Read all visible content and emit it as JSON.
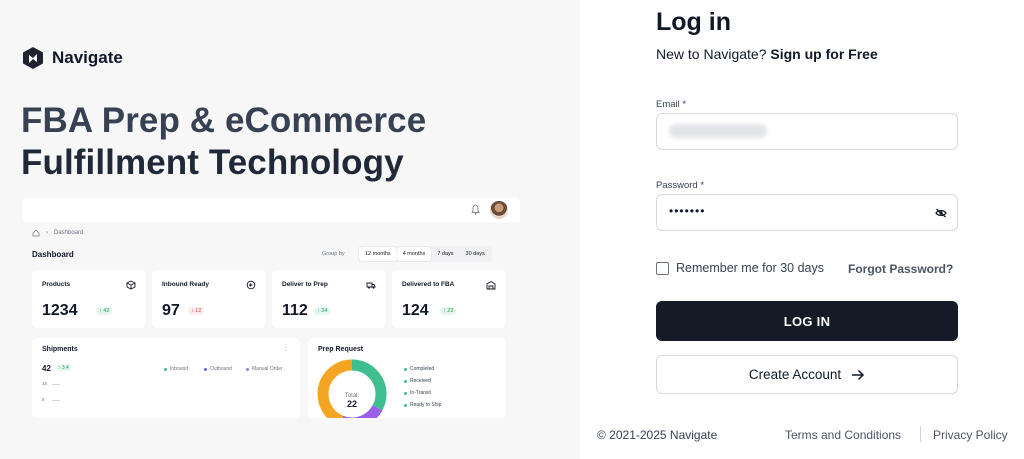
{
  "brand": {
    "name": "Navigate"
  },
  "hero": {
    "line1": "FBA Prep & eCommerce",
    "line2": "Fulfillment Technology"
  },
  "dashboard": {
    "breadcrumb": "Dashboard",
    "title": "Dashboard",
    "group_by_label": "Group by",
    "periods": [
      "12 months",
      "4 months",
      "7 days",
      "30 days"
    ],
    "cards": [
      {
        "title": "Products",
        "value": "1234",
        "badge": "↑ 42",
        "trend": "up",
        "icon": "cube-icon"
      },
      {
        "title": "Inbound Ready",
        "value": "97",
        "badge": "↓ 12",
        "trend": "down",
        "icon": "inbound-icon"
      },
      {
        "title": "Deliver to Prep",
        "value": "112",
        "badge": "↑ 34",
        "trend": "up",
        "icon": "truck-icon"
      },
      {
        "title": "Delivered to FBA",
        "value": "124",
        "badge": "↑ 23",
        "trend": "up",
        "icon": "warehouse-icon"
      }
    ],
    "shipments": {
      "title": "Shipments",
      "value": "42",
      "badge": "↑ 3.4",
      "legend": [
        "Inbound",
        "Outbound",
        "Manual Order"
      ],
      "legend_colors": [
        "#3fbf8f",
        "#5b63e6",
        "#9b7be8"
      ],
      "axis": [
        "15",
        "8"
      ]
    },
    "prep_request": {
      "title": "Prep Request",
      "total_label": "Total:",
      "total_value": "22",
      "legend": [
        "Completed",
        "Received",
        "In-Transit",
        "Ready to Ship"
      ],
      "legend_colors": [
        "#3fbf8f",
        "#3fbf8f",
        "#3fbf8f",
        "#3fbf8f"
      ]
    }
  },
  "login": {
    "title": "Log in",
    "subtitle_prefix": "New to Navigate?",
    "signup_link": "Sign up for Free",
    "email_label": "Email *",
    "password_label": "Password *",
    "password_mask": "•••••••",
    "remember_label": "Remember me for 30 days",
    "forgot_link": "Forgot Password?",
    "login_button": "LOG IN",
    "create_button": "Create Account"
  },
  "footer": {
    "copyright": "© 2021-2025 Navigate",
    "terms": "Terms and Conditions",
    "privacy": "Privacy Policy"
  }
}
